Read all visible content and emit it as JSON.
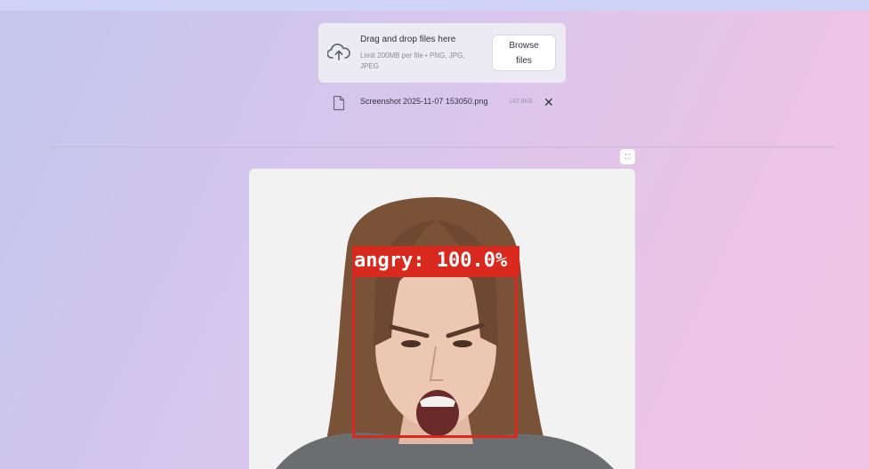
{
  "uploader": {
    "drop_label": "Drag and drop files here",
    "limit_text": "Limit 200MB per file • PNG, JPG, JPEG",
    "browse_line1": "Browse",
    "browse_line2": "files",
    "icon": "cloud-upload-icon"
  },
  "uploaded_file": {
    "name": "Screenshot 2025-11-07 153050.png",
    "size": "142.8KB",
    "icon": "file-icon",
    "remove_icon": "close-icon"
  },
  "result_image": {
    "fullscreen_icon": "fullscreen-icon",
    "detection": {
      "label": "angry: 100.0%",
      "emotion": "angry",
      "confidence_percent": 100.0
    }
  },
  "colors": {
    "box": "#d9281e",
    "text": "#31333f",
    "muted": "#8a8c96"
  }
}
